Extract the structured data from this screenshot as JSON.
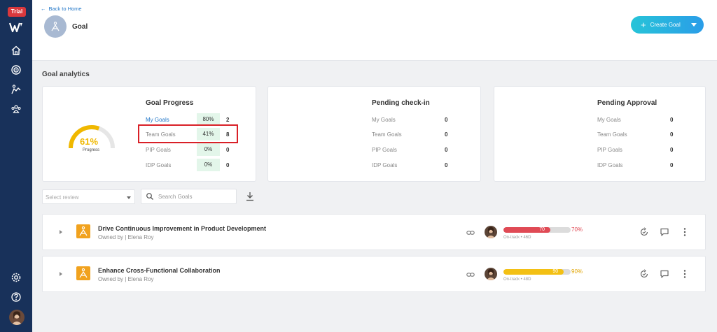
{
  "sidebar": {
    "trial_badge": "Trial",
    "items": [
      "home-icon",
      "target-icon",
      "goal-icon",
      "people-icon"
    ],
    "bottom": [
      "settings-icon",
      "help-icon"
    ]
  },
  "header": {
    "back_link": "Back to Home",
    "title": "Goal",
    "create_button": "Create Goal"
  },
  "analytics": {
    "title": "Goal analytics",
    "progress_card": {
      "title": "Goal Progress",
      "gauge_value": "61%",
      "gauge_label": "Progress",
      "gauge_fraction": 0.61,
      "rows": [
        {
          "label": "My Goals",
          "pct": "80%",
          "count": "2"
        },
        {
          "label": "Team Goals",
          "pct": "41%",
          "count": "8"
        },
        {
          "label": "PIP Goals",
          "pct": "0%",
          "count": "0"
        },
        {
          "label": "IDP Goals",
          "pct": "0%",
          "count": "0"
        }
      ]
    },
    "checkin_card": {
      "title": "Pending check-in",
      "rows": [
        {
          "label": "My Goals",
          "count": "0"
        },
        {
          "label": "Team Goals",
          "count": "0"
        },
        {
          "label": "PIP Goals",
          "count": "0"
        },
        {
          "label": "IDP Goals",
          "count": "0"
        }
      ]
    },
    "approval_card": {
      "title": "Pending Approval",
      "rows": [
        {
          "label": "My Goals",
          "count": "0"
        },
        {
          "label": "Team Goals",
          "count": "0"
        },
        {
          "label": "PIP Goals",
          "count": "0"
        },
        {
          "label": "IDP Goals",
          "count": "0"
        }
      ]
    }
  },
  "filters": {
    "select_review_placeholder": "Select review",
    "search_placeholder": "Search Goals"
  },
  "goals": [
    {
      "name": "Drive Continuous Improvement in Product Development",
      "owner": "Owned by | Elena Roy",
      "progress_value": "70",
      "progress_fraction": 0.7,
      "target": "70%",
      "status": "On-track  •  46D",
      "bar_color": "#e04a55",
      "target_color": "#e04a55"
    },
    {
      "name": "Enhance Cross-Functional Collaboration",
      "owner": "Owned by | Elena Roy",
      "progress_value": "90",
      "progress_fraction": 0.9,
      "target": "90%",
      "status": "On-track  •  48D",
      "bar_color": "#f3c014",
      "target_color": "#e0a400"
    }
  ],
  "colors": {
    "sidebar": "#18315a",
    "accent": "#2a9de8",
    "highlight": "#d92027",
    "gauge": "#f0b800"
  }
}
